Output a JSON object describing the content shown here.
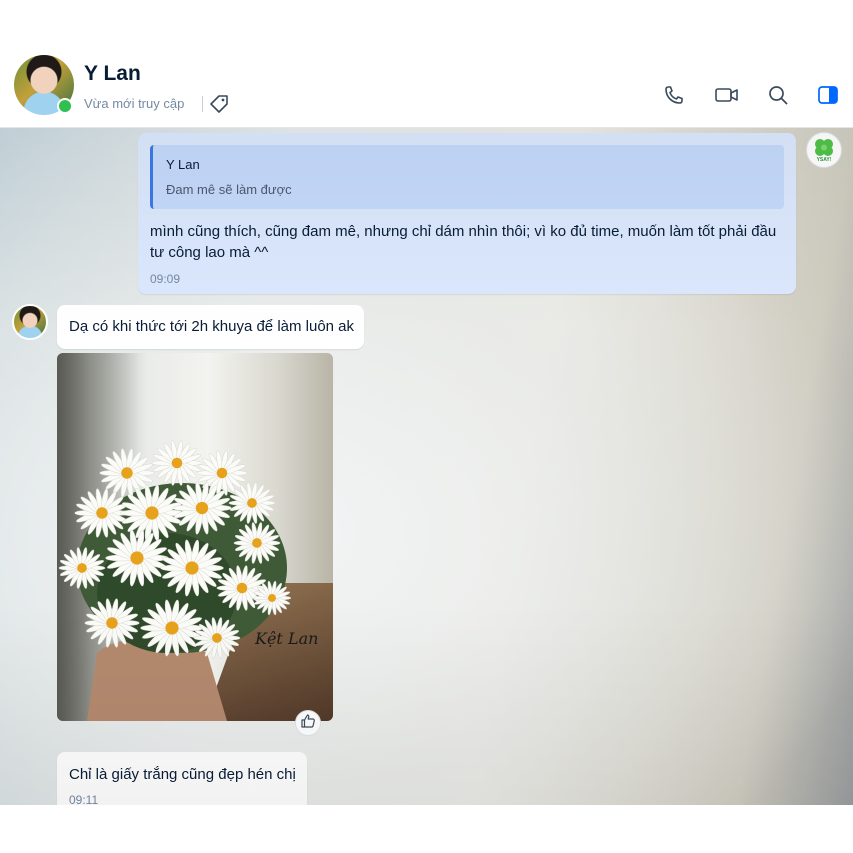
{
  "header": {
    "contact_name": "Y Lan",
    "status": "Vừa mới truy cập",
    "icons": [
      "phone-icon",
      "video-call-icon",
      "search-icon",
      "sidebar-toggle-icon"
    ],
    "accent_color": "#0068ff",
    "online_color": "#30c04f"
  },
  "messages": [
    {
      "direction": "outgoing",
      "quote": {
        "sender": "Y Lan",
        "text": "Đam mê sẽ làm được"
      },
      "text": "mình cũng thích, cũng đam mê, nhưng chỉ dám nhìn thôi; vì ko đủ time, muốn làm tốt phải đầu tư công lao mà ^^",
      "time": "09:09"
    },
    {
      "direction": "incoming",
      "text": "Dạ có khi thức tới 2h khuya để làm luôn ak"
    },
    {
      "direction": "incoming",
      "type": "image",
      "signature": "Kệt Lan",
      "reaction_icon": "thumbs-up-icon"
    },
    {
      "direction": "incoming",
      "text": "Chỉ là giấy trắng cũng đẹp hén chị",
      "time": "09:11"
    }
  ],
  "self_avatar_label": "YSAY!"
}
